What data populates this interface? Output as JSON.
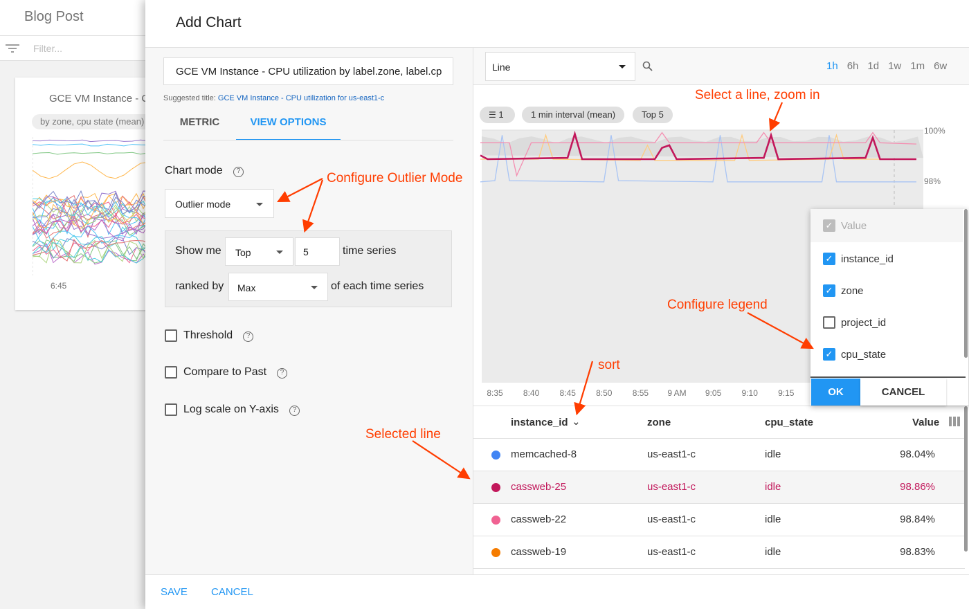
{
  "background": {
    "page_title": "Blog Post",
    "filter_placeholder": "Filter...",
    "card_title": "GCE VM Instance - C",
    "card_chip": "by zone, cpu state (mean)",
    "card_tick": "6:45"
  },
  "dialog": {
    "title": "Add Chart",
    "chart_title_value": "GCE VM Instance - CPU utilization by label.zone, label.cp",
    "suggested_label": "Suggested title:",
    "suggested_value": "GCE VM Instance - CPU utilization for us-east1-c",
    "tabs": [
      {
        "label": "METRIC",
        "active": false
      },
      {
        "label": "VIEW OPTIONS",
        "active": true
      }
    ],
    "chart_mode_label": "Chart mode",
    "chart_mode_value": "Outlier mode",
    "show_me_label": "Show me",
    "show_me_value": "Top",
    "count_value": "5",
    "time_series_label": "time series",
    "ranked_by_label": "ranked by",
    "ranked_by_value": "Max",
    "of_each_label": "of each time series",
    "options": [
      {
        "label": "Threshold",
        "checked": false
      },
      {
        "label": "Compare to Past",
        "checked": false
      },
      {
        "label": "Log scale on Y-axis",
        "checked": false
      }
    ],
    "save": "SAVE",
    "cancel": "CANCEL"
  },
  "preview": {
    "chart_type": "Line",
    "ranges": [
      {
        "label": "1h",
        "active": true
      },
      {
        "label": "6h"
      },
      {
        "label": "1d"
      },
      {
        "label": "1w"
      },
      {
        "label": "1m"
      },
      {
        "label": "6w"
      }
    ],
    "chips": {
      "filter_count": "1",
      "interval": "1 min interval (mean)",
      "top": "Top 5"
    },
    "legend_menu": {
      "items": [
        {
          "label": "Value",
          "checked": true,
          "disabled": true
        },
        {
          "label": "instance_id",
          "checked": true
        },
        {
          "label": "zone",
          "checked": true
        },
        {
          "label": "project_id",
          "checked": false
        },
        {
          "label": "cpu_state",
          "checked": true
        }
      ],
      "ok": "OK",
      "cancel": "CANCEL"
    },
    "table": {
      "headers": [
        "instance_id",
        "zone",
        "cpu_state",
        "Value"
      ],
      "rows": [
        {
          "color": "#4285f4",
          "instance_id": "memcached-8",
          "zone": "us-east1-c",
          "cpu_state": "idle",
          "value": "98.04%",
          "selected": false
        },
        {
          "color": "#c2185b",
          "instance_id": "cassweb-25",
          "zone": "us-east1-c",
          "cpu_state": "idle",
          "value": "98.86%",
          "selected": true
        },
        {
          "color": "#f06292",
          "instance_id": "cassweb-22",
          "zone": "us-east1-c",
          "cpu_state": "idle",
          "value": "98.84%",
          "selected": false
        },
        {
          "color": "#f57c00",
          "instance_id": "cassweb-19",
          "zone": "us-east1-c",
          "cpu_state": "idle",
          "value": "98.83%",
          "selected": false
        }
      ]
    }
  },
  "chart_data": {
    "type": "line",
    "x_ticks": [
      "8:35",
      "8:40",
      "8:45",
      "8:50",
      "8:55",
      "9 AM",
      "9:05",
      "9:10",
      "9:15"
    ],
    "y_ticks": [
      "100%",
      "98%"
    ],
    "series": [
      {
        "name": "memcached-8",
        "color": "#a8c4f4",
        "points": [
          [
            "8:33",
            97.95
          ],
          [
            "8:35",
            98.0
          ],
          [
            "8:36",
            99.8
          ],
          [
            "8:37",
            98.0
          ],
          [
            "8:50",
            97.95
          ],
          [
            "8:51",
            99.8
          ],
          [
            "8:52",
            98.0
          ],
          [
            "9:05",
            97.95
          ],
          [
            "9:06",
            99.8
          ],
          [
            "9:07",
            97.95
          ],
          [
            "9:20",
            97.95
          ],
          [
            "9:21",
            99.8
          ],
          [
            "9:22",
            97.95
          ],
          [
            "9:33",
            97.95
          ]
        ]
      },
      {
        "name": "cassweb-19",
        "color": "#ffcc80",
        "points": [
          [
            "8:33",
            98.85
          ],
          [
            "8:41",
            98.85
          ],
          [
            "8:42",
            99.8
          ],
          [
            "8:43",
            98.85
          ],
          [
            "8:55",
            98.8
          ],
          [
            "8:56",
            99.4
          ],
          [
            "8:57",
            98.8
          ],
          [
            "9:08",
            98.8
          ],
          [
            "9:09",
            99.8
          ],
          [
            "9:10",
            98.8
          ],
          [
            "9:21",
            98.85
          ],
          [
            "9:22",
            99.8
          ],
          [
            "9:23",
            98.85
          ],
          [
            "9:33",
            98.85
          ]
        ]
      },
      {
        "name": "cassweb-22",
        "color": "#f48fb1",
        "points": [
          [
            "8:33",
            99.5
          ],
          [
            "8:37",
            99.5
          ],
          [
            "8:38",
            98.2
          ],
          [
            "8:40",
            99.5
          ],
          [
            "8:57",
            99.5
          ],
          [
            "8:58",
            99.9
          ],
          [
            "8:59",
            99.5
          ],
          [
            "9:11",
            99.5
          ],
          [
            "9:12",
            99.9
          ],
          [
            "9:13",
            99.5
          ],
          [
            "9:26",
            99.5
          ],
          [
            "9:27",
            99.9
          ],
          [
            "9:28",
            99.5
          ],
          [
            "9:33",
            99.45
          ]
        ]
      },
      {
        "name": "cassweb-25",
        "color": "#c2185b",
        "points": [
          [
            "8:33",
            99.0
          ],
          [
            "8:34",
            98.85
          ],
          [
            "8:45",
            98.9
          ],
          [
            "8:46",
            99.85
          ],
          [
            "8:47",
            98.85
          ],
          [
            "8:57",
            98.85
          ],
          [
            "8:58",
            99.3
          ],
          [
            "8:59",
            99.4
          ],
          [
            "9:00",
            98.85
          ],
          [
            "9:12",
            98.9
          ],
          [
            "9:13",
            99.8
          ],
          [
            "9:14",
            98.85
          ],
          [
            "9:26",
            98.9
          ],
          [
            "9:27",
            99.7
          ],
          [
            "9:28",
            98.85
          ],
          [
            "9:33",
            98.85
          ]
        ]
      }
    ]
  },
  "annotations": {
    "outlier": "Configure Outlier Mode",
    "zoom": "Select a line, zoom in",
    "legend": "Configure legend",
    "sort": "sort",
    "selected": "Selected line"
  },
  "colors": {
    "accent": "#2196f3",
    "annotation": "#ff3d00",
    "selected": "#c2185b"
  }
}
